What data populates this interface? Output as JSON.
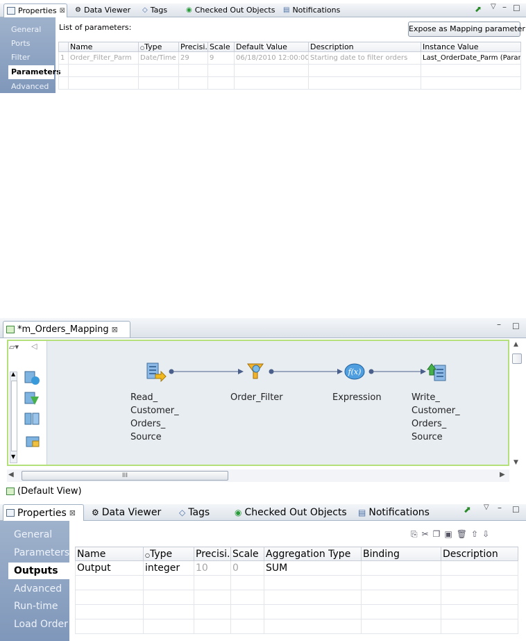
{
  "top_panel": {
    "tabs": [
      {
        "label": "Properties",
        "close": "⊠"
      },
      {
        "label": "Data Viewer"
      },
      {
        "label": "Tags"
      },
      {
        "label": "Checked Out Objects"
      },
      {
        "label": "Notifications"
      }
    ],
    "sidebar": [
      "General",
      "Ports",
      "Filter",
      "Parameters",
      "Advanced"
    ],
    "list_label": "List of parameters:",
    "expose_button": "Expose as Mapping parameter",
    "columns": [
      "Name",
      "Type",
      "Precisi...",
      "Scale",
      "Default Value",
      "Description",
      "Instance Value"
    ],
    "rows": [
      {
        "num": "1",
        "name": "Order_Filter_Parm",
        "type": "Date/Time",
        "precision": "29",
        "scale": "9",
        "default": "06/18/2010 12:00:00",
        "description": "Starting date to filter orders",
        "instance": "Last_OrderDate_Parm (Paran"
      }
    ]
  },
  "mapping_editor": {
    "title": "*m_Orders_Mapping",
    "close": "⊠",
    "nodes": [
      {
        "label": "Read_\nCustomer_\nOrders_\nSource",
        "icon": "read-source-icon"
      },
      {
        "label": "Order_Filter",
        "icon": "filter-icon"
      },
      {
        "label": "Expression",
        "icon": "expression-icon"
      },
      {
        "label": "Write_\nCustomer_\nOrders_\nSource",
        "icon": "write-target-icon"
      }
    ],
    "scroll_label": "III",
    "view_tab": "(Default View)"
  },
  "bottom_panel": {
    "tabs": [
      {
        "label": "Properties",
        "close": "⊠"
      },
      {
        "label": "Data Viewer"
      },
      {
        "label": "Tags"
      },
      {
        "label": "Checked Out Objects"
      },
      {
        "label": "Notifications"
      }
    ],
    "sidebar": [
      "General",
      "Parameters",
      "Outputs",
      "Advanced",
      "Run-time",
      "Load Order"
    ],
    "columns": [
      "Name",
      "Type",
      "Precisi...",
      "Scale",
      "Aggregation Type",
      "Binding",
      "Description"
    ],
    "rows": [
      {
        "name": "Output",
        "type": "integer",
        "precision": "10",
        "scale": "0",
        "aggregation": "SUM",
        "binding": "",
        "description": ""
      }
    ]
  },
  "colors": {
    "accent": "#8fb0d8",
    "canvas": "#e8edf2",
    "canvas_border": "#b4e07a"
  }
}
